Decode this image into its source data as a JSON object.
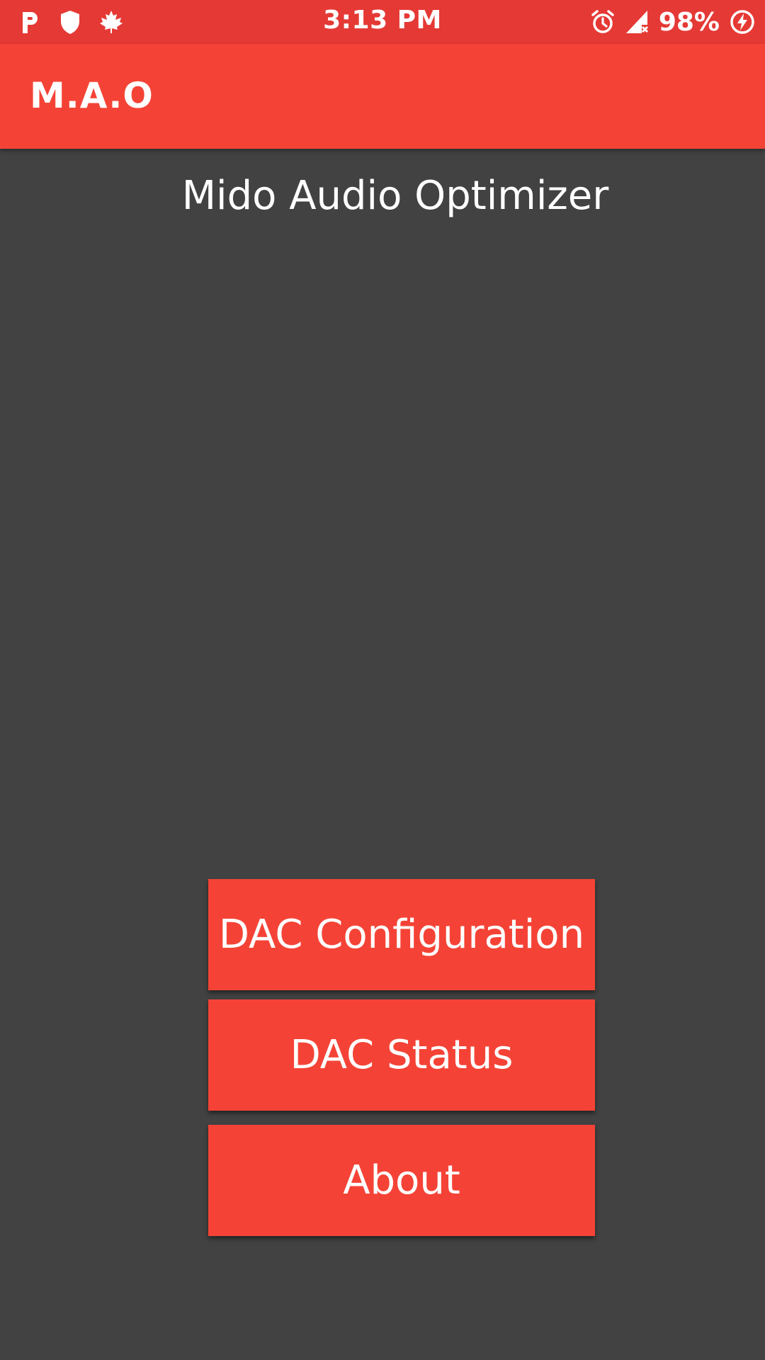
{
  "status_bar": {
    "time": "3:13 PM",
    "battery": "98%",
    "icons_left": [
      "p-icon",
      "shield-icon",
      "maple-leaf-icon"
    ],
    "icons_right": [
      "alarm-icon",
      "signal-no-service-icon",
      "battery-charging-icon"
    ]
  },
  "app_bar": {
    "title": "M.A.O"
  },
  "main": {
    "heading": "Mido Audio Optimizer",
    "buttons": {
      "dac_configuration": "DAC Configuration",
      "dac_status": "DAC Status",
      "about": "About"
    }
  },
  "colors": {
    "status_bar": "#E53935",
    "primary": "#F44336",
    "background": "#424242",
    "text": "#FFFFFF"
  }
}
